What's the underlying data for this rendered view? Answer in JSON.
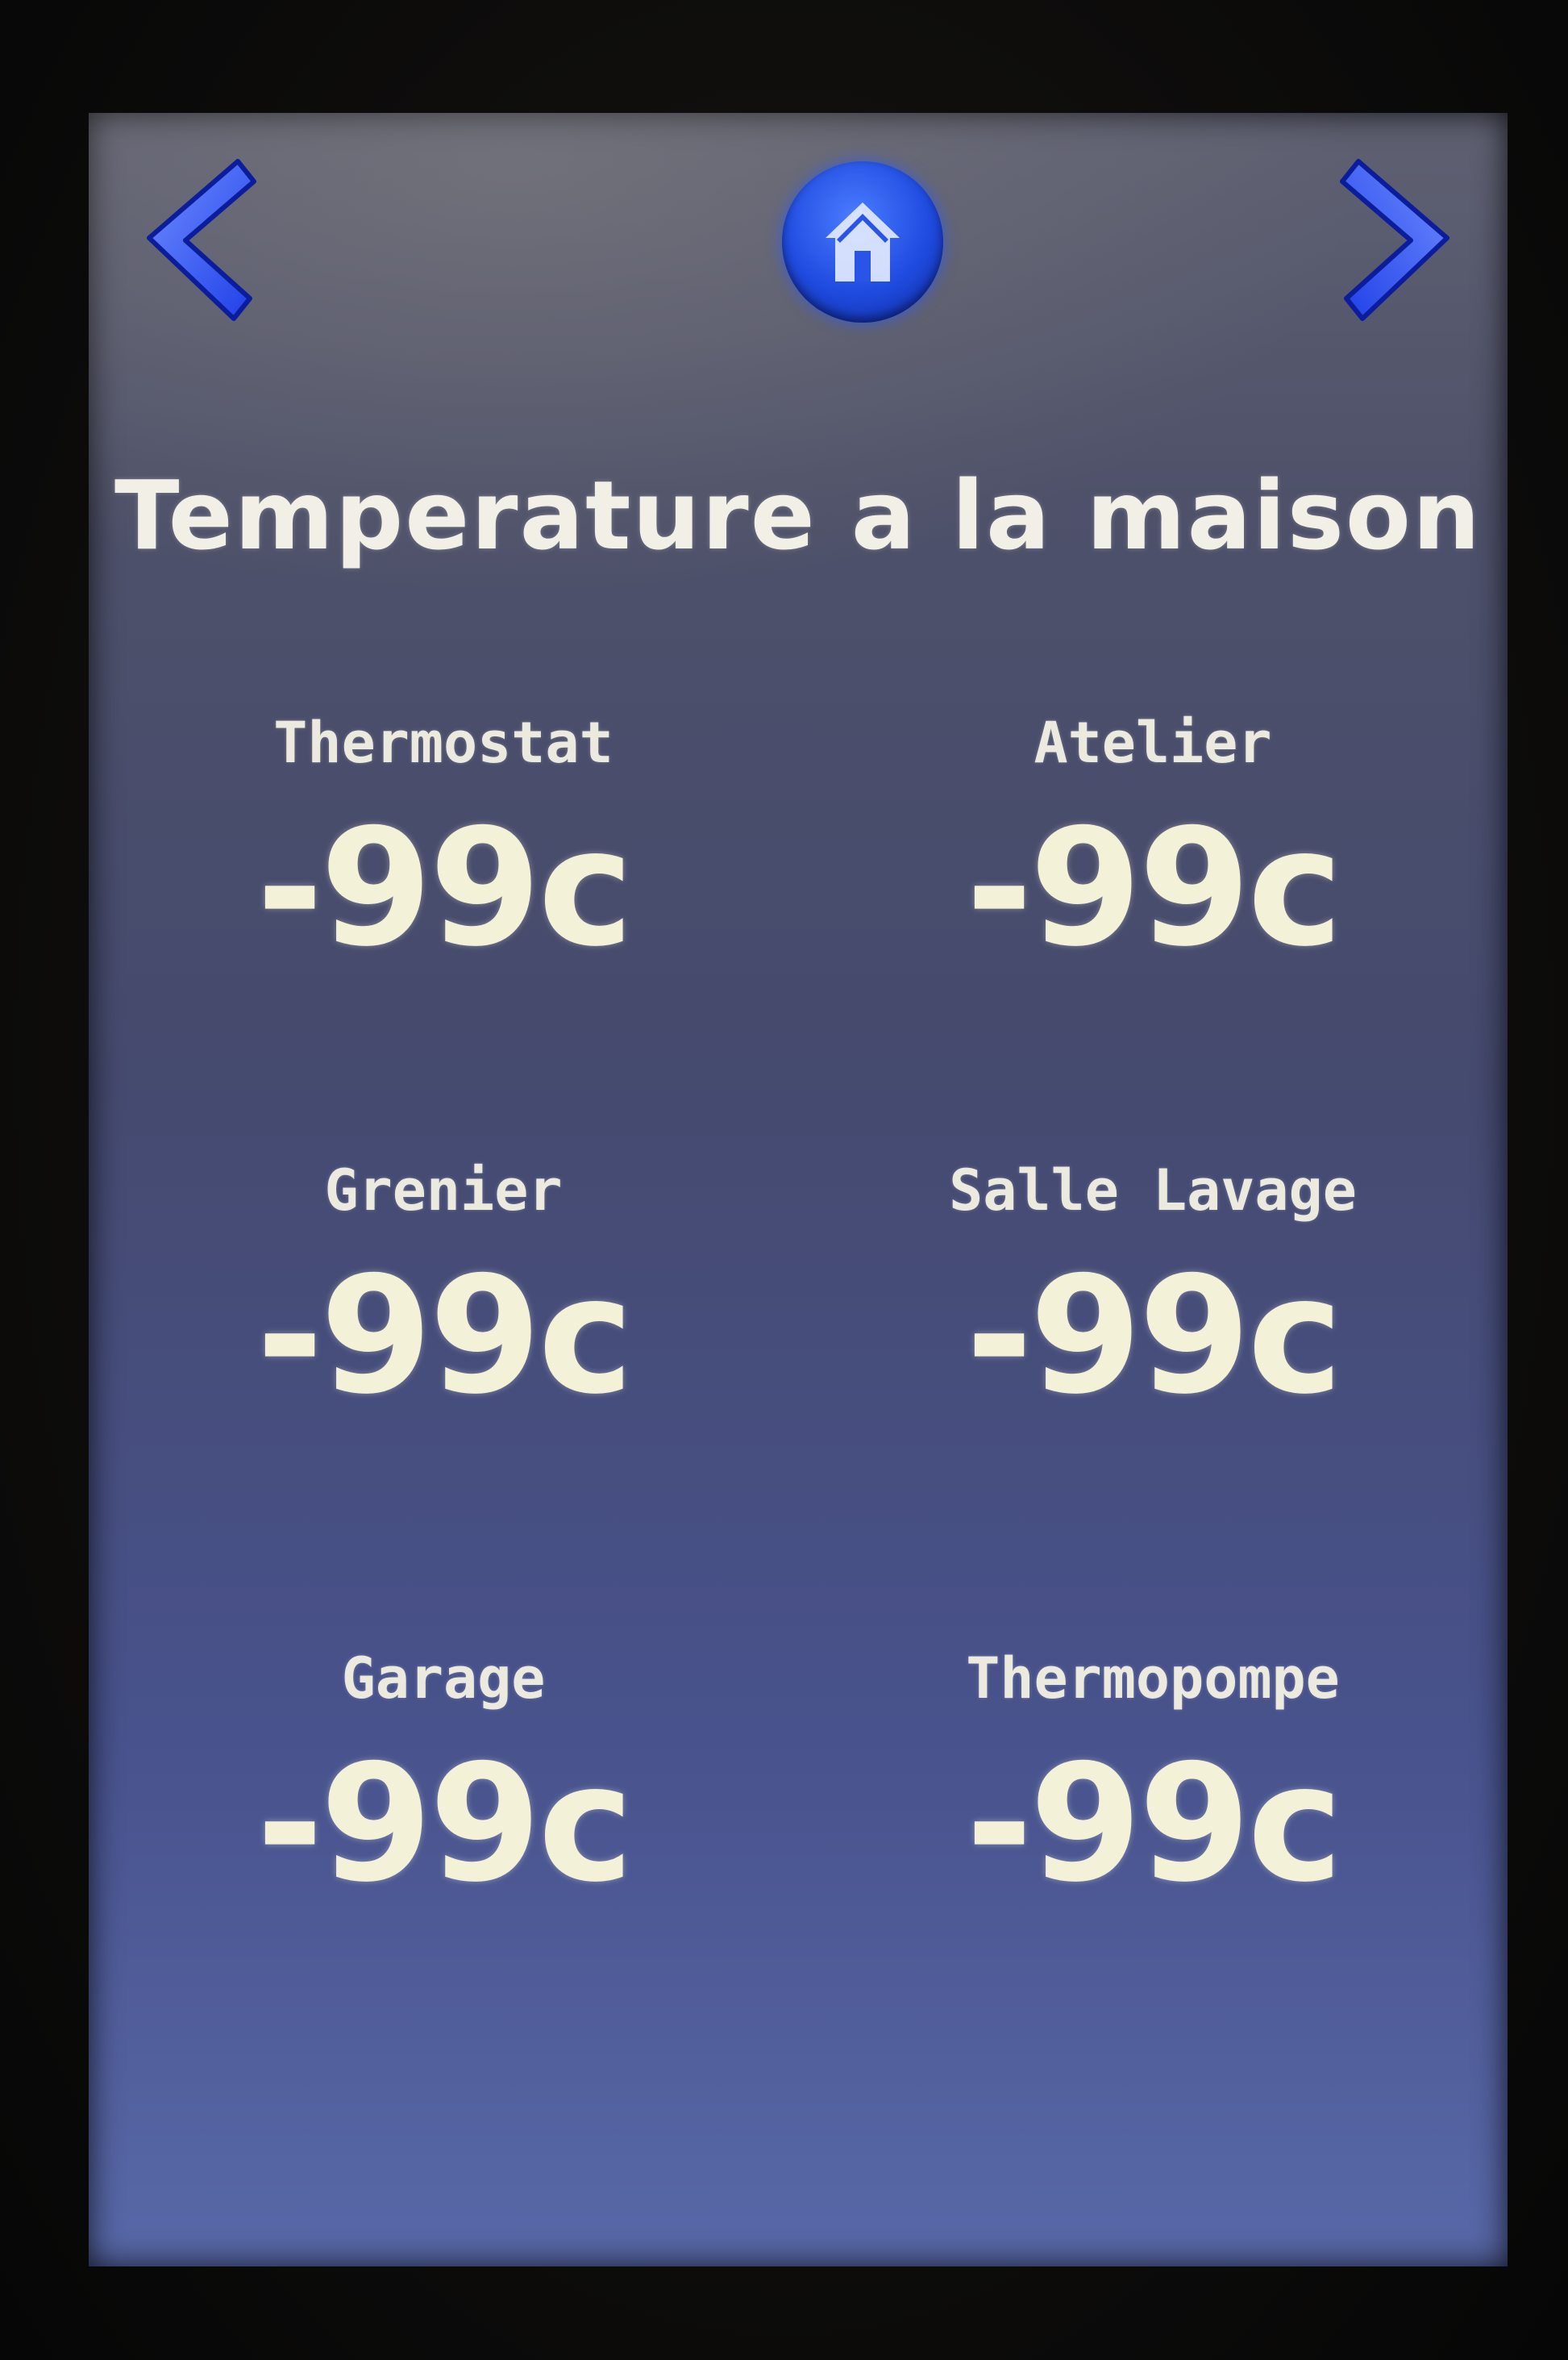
{
  "nav": {
    "prev_icon": "chevron-left-icon",
    "home_icon": "home-icon",
    "next_icon": "chevron-right-icon",
    "accent_color": "#2a5bff"
  },
  "title": "Temperature a la maison",
  "sensors": [
    {
      "label": "Thermostat",
      "value": "-99c"
    },
    {
      "label": "Atelier",
      "value": "-99c"
    },
    {
      "label": "Grenier",
      "value": "-99c"
    },
    {
      "label": "Salle Lavage",
      "value": "-99c"
    },
    {
      "label": "Garage",
      "value": "-99c"
    },
    {
      "label": "Thermopompe",
      "value": "-99c"
    }
  ]
}
